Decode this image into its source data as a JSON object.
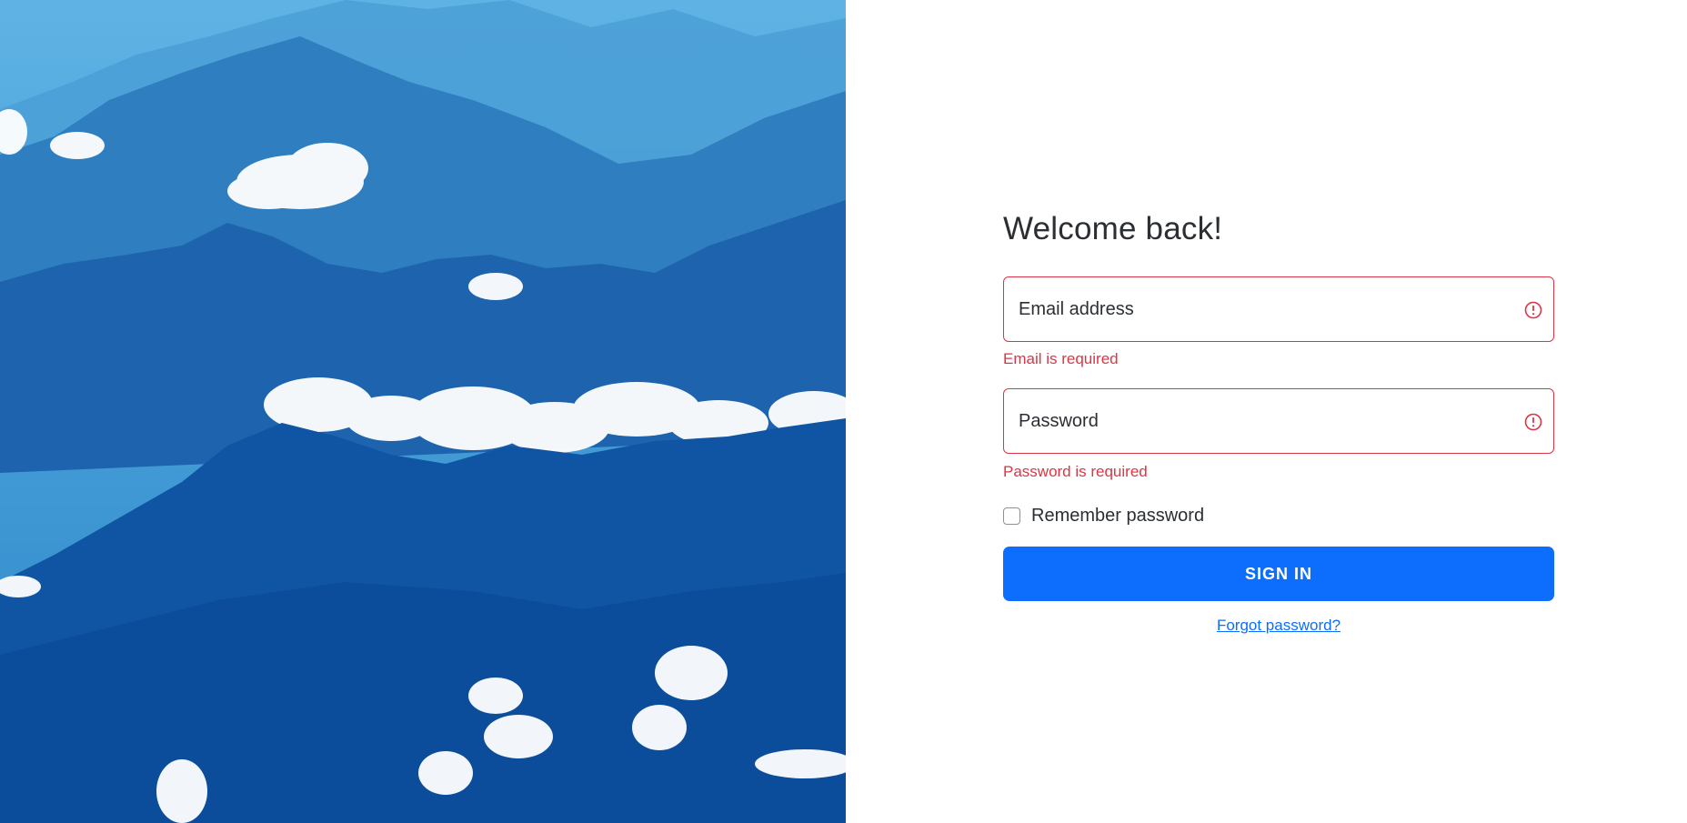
{
  "login": {
    "title": "Welcome back!",
    "email": {
      "placeholder": "Email address",
      "value": "",
      "error": "Email is required"
    },
    "password": {
      "placeholder": "Password",
      "value": "",
      "error": "Password is required"
    },
    "remember_label": "Remember password",
    "remember_checked": false,
    "signin_label": "SIGN IN",
    "forgot_label": "Forgot password?"
  },
  "colors": {
    "error": "#dc3545",
    "primary": "#0d6efd"
  },
  "icons": {
    "field_error": "exclamation-circle-icon"
  }
}
